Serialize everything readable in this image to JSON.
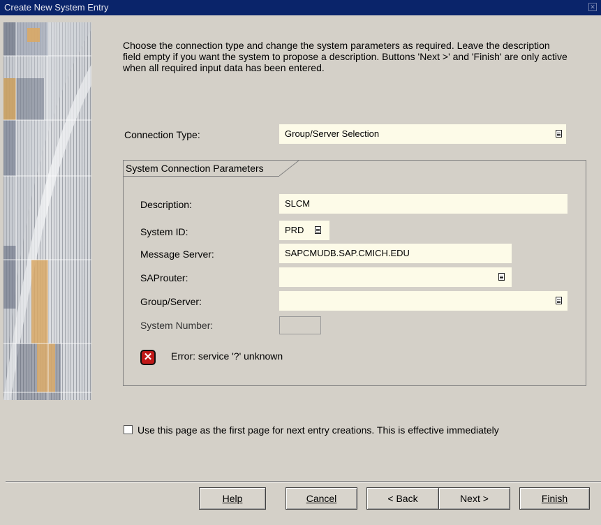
{
  "window": {
    "title": "Create New System Entry",
    "close_label": "✕"
  },
  "intro": {
    "text": "Choose the connection type and change the system parameters as required. Leave the description field empty if you want the system to propose a description. Buttons 'Next >' and 'Finish' are only active when all required input data has been entered."
  },
  "connection_type": {
    "label": "Connection Type:",
    "value": "Group/Server Selection"
  },
  "params": {
    "group_title": "System Connection Parameters",
    "description_label": "Description:",
    "description_value": "SLCM",
    "system_id_label": "System ID:",
    "system_id_value": "PRD",
    "message_server_label": "Message Server:",
    "message_server_value": "SAPCMUDB.SAP.CMICH.EDU",
    "saprouter_label": "SAProuter:",
    "saprouter_value": "",
    "group_server_label": "Group/Server:",
    "group_server_value": "",
    "system_number_label": "System Number:",
    "system_number_value": "",
    "error_text": "Error: service '?' unknown"
  },
  "first_page_option": {
    "label": "Use this page as the first page for next entry creations. This is effective immediately",
    "checked": false
  },
  "buttons": {
    "help": "Help",
    "cancel": "Cancel",
    "back": "< Back",
    "next": "Next >",
    "finish": "Finish"
  },
  "colors": {
    "title_bar": "#0a246a",
    "input_background": "#fdfbe8",
    "dialog_background": "#d4d0c8",
    "error_icon": "#c01818"
  }
}
